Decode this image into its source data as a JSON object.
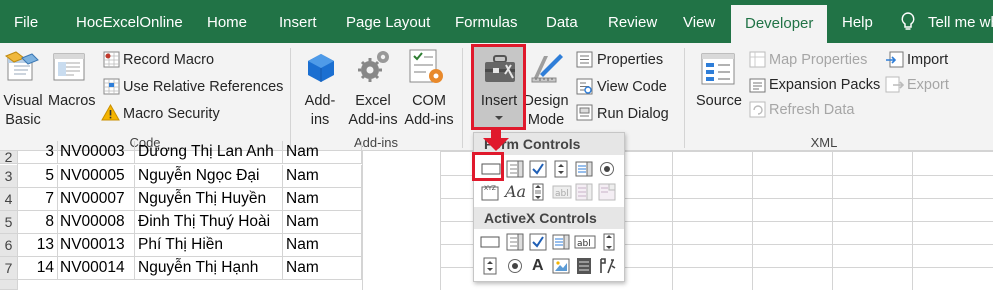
{
  "tabs": [
    "File",
    "HocExcelOnline",
    "Home",
    "Insert",
    "Page Layout",
    "Formulas",
    "Data",
    "Review",
    "View",
    "Developer",
    "Help"
  ],
  "tell_me": "Tell me wh",
  "ribbon": {
    "code": {
      "visual_basic": [
        "Visual",
        "Basic"
      ],
      "macros": "Macros",
      "record_macro": "Record Macro",
      "use_relative": "Use Relative References",
      "macro_security": "Macro Security",
      "group": "Code"
    },
    "addins": {
      "addins": [
        "Add-",
        "ins"
      ],
      "excel_addins": [
        "Excel",
        "Add-ins"
      ],
      "com_addins": [
        "COM",
        "Add-ins"
      ],
      "group": "Add-ins"
    },
    "controls": {
      "insert": "Insert",
      "design_mode": [
        "Design",
        "Mode"
      ],
      "properties": "Properties",
      "view_code": "View Code",
      "run_dialog": "Run Dialog"
    },
    "xml": {
      "source": "Source",
      "map_properties": "Map Properties",
      "expansion_packs": "Expansion Packs",
      "refresh_data": "Refresh Data",
      "import": "Import",
      "export": "Export",
      "group": "XML"
    }
  },
  "dropdown": {
    "form_controls": "Form Controls",
    "activex_controls": "ActiveX Controls"
  },
  "rows": [
    {
      "num": "2",
      "id": "3",
      "code": "NV00003",
      "name": "Dương Thị Lan Anh",
      "gender": "Nam"
    },
    {
      "num": "3",
      "id": "5",
      "code": "NV00005",
      "name": "Nguyễn Ngọc Đại",
      "gender": "Nam"
    },
    {
      "num": "4",
      "id": "7",
      "code": "NV00007",
      "name": "Nguyễn Thị Huyền",
      "gender": "Nam"
    },
    {
      "num": "5",
      "id": "8",
      "code": "NV00008",
      "name": "Đinh Thị Thuý Hoài",
      "gender": "Nam"
    },
    {
      "num": "6",
      "id": "13",
      "code": "NV00013",
      "name": "Phí Thị Hiền",
      "gender": "Nam"
    },
    {
      "num": "7",
      "id": "14",
      "code": "NV00014",
      "name": "Nguyễn Thị Hạnh",
      "gender": "Nam"
    }
  ],
  "colors": {
    "brand": "#217346",
    "highlight": "#e0192c"
  }
}
